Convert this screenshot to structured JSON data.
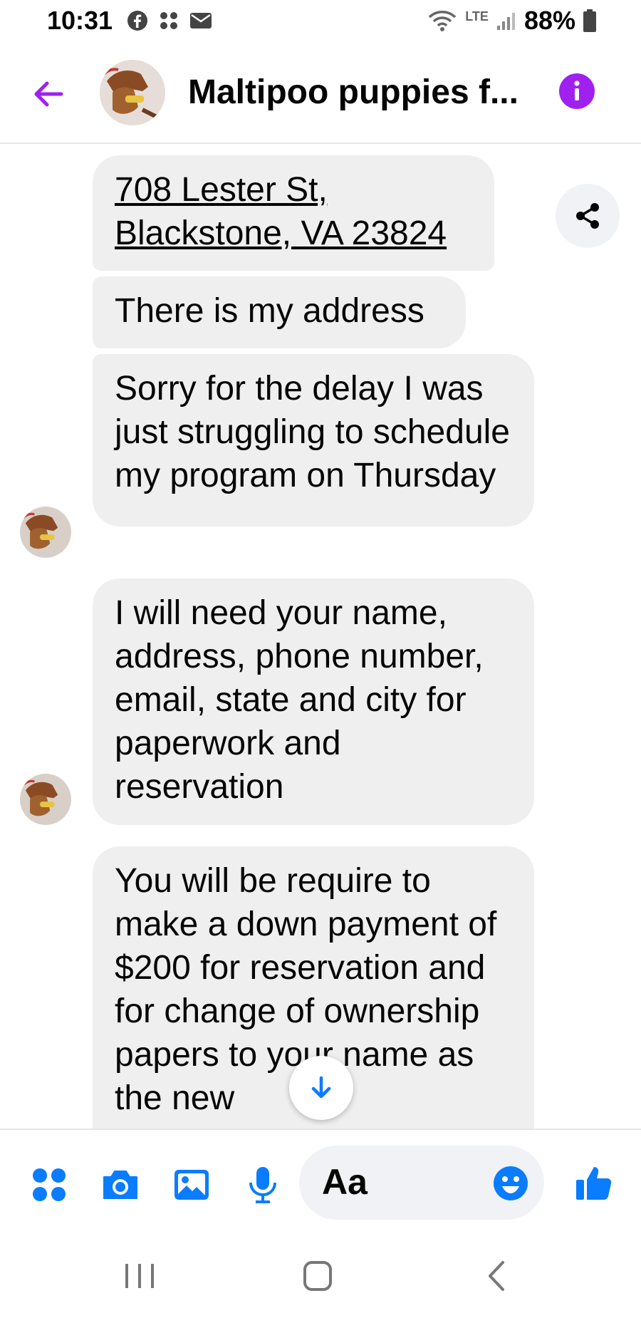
{
  "status_bar": {
    "time": "10:31",
    "network": "LTE",
    "battery": "88%",
    "icons": [
      "facebook-icon",
      "grid-dots-icon",
      "mail-icon",
      "wifi-icon",
      "signal-icon",
      "battery-icon"
    ]
  },
  "header": {
    "title": "Maltipoo puppies f...",
    "icons": [
      "back-arrow-icon",
      "info-icon"
    ]
  },
  "messages": [
    {
      "text": "708 Lester St,\nBlackstone, VA 23824",
      "kind": "link"
    },
    {
      "text": "There is my address"
    },
    {
      "text": "Sorry for the delay I was just struggling to schedule my program on Thursday"
    },
    {
      "text": "I will need your name, address, phone number, email, state and city for paperwork and reservation"
    },
    {
      "text": "You will be require to make a down payment of $200 for reservation and for change of ownership papers to your name as the new"
    }
  ],
  "composer": {
    "placeholder": "Aa",
    "icons": [
      "apps-icon",
      "camera-icon",
      "gallery-icon",
      "microphone-icon",
      "emoji-icon",
      "thumbs-up-icon"
    ]
  },
  "colors": {
    "accent": "#a020f0",
    "messenger_blue": "#0a7cff",
    "bubble_bg": "#efefef"
  }
}
